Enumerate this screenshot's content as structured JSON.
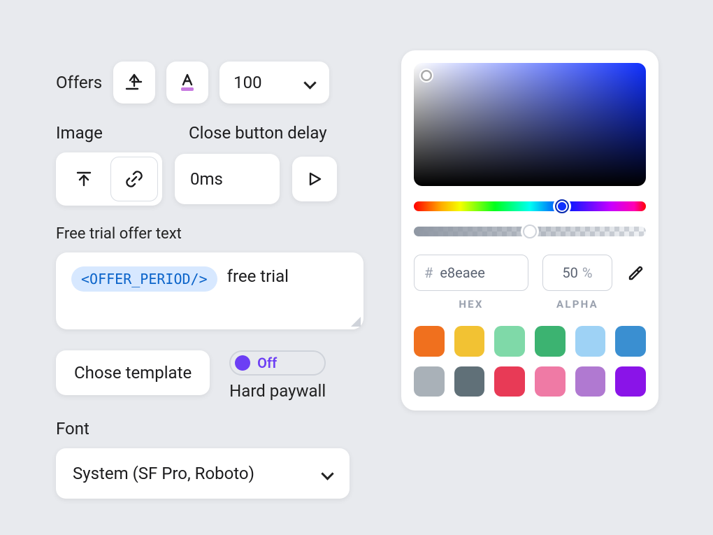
{
  "offers": {
    "label": "Offers",
    "font_size": "100"
  },
  "image": {
    "label": "Image"
  },
  "close_delay": {
    "label": "Close button delay",
    "value": "0ms"
  },
  "free_trial": {
    "label": "Free trial offer text",
    "token": "<OFFER_PERIOD/>",
    "suffix": "free trial"
  },
  "template": {
    "button": "Chose template",
    "toggle_state": "Off",
    "toggle_caption": "Hard paywall"
  },
  "font": {
    "label": "Font",
    "value": "System (SF Pro, Roboto)"
  },
  "picker": {
    "hex": "e8eaee",
    "alpha": "50",
    "alpha_unit": "%",
    "hex_label": "HEX",
    "alpha_label": "ALPHA",
    "swatches": [
      "#f0701e",
      "#f2c233",
      "#7fd9a8",
      "#3cb371",
      "#9ed2f5",
      "#3a8fd1",
      "#a9b1b8",
      "#607078",
      "#e83a56",
      "#ef7aa5",
      "#b079d1",
      "#8a14e8"
    ]
  }
}
